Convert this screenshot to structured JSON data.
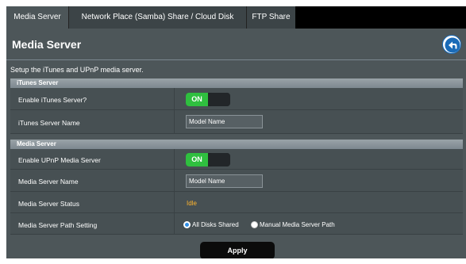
{
  "tabs": [
    {
      "label": "Media Server",
      "active": true
    },
    {
      "label": "Network Place (Samba) Share / Cloud Disk",
      "active": false
    },
    {
      "label": "FTP Share",
      "active": false
    }
  ],
  "page_title": "Media Server",
  "back_icon": "back-arrow-icon",
  "description": "Setup the iTunes and UPnP media server.",
  "itunes": {
    "header": "iTunes Server",
    "enable_label": "Enable iTunes Server?",
    "enable_state": "ON",
    "name_label": "iTunes Server Name",
    "name_value": "Model Name"
  },
  "media": {
    "header": "Media Server",
    "enable_label": "Enable UPnP Media Server",
    "enable_state": "ON",
    "name_label": "Media Server Name",
    "name_value": "Model Name",
    "status_label": "Media Server Status",
    "status_value": "Idle",
    "path_label": "Media Server Path Setting",
    "path_options": [
      "All Disks Shared",
      "Manual Media Server Path"
    ],
    "path_selected": "All Disks Shared"
  },
  "apply_label": "Apply",
  "colors": {
    "toggle_on": "#2fbf3f",
    "status": "#ffb52e",
    "radio_selected": "#2f8ee6",
    "panel": "#4d5659"
  }
}
